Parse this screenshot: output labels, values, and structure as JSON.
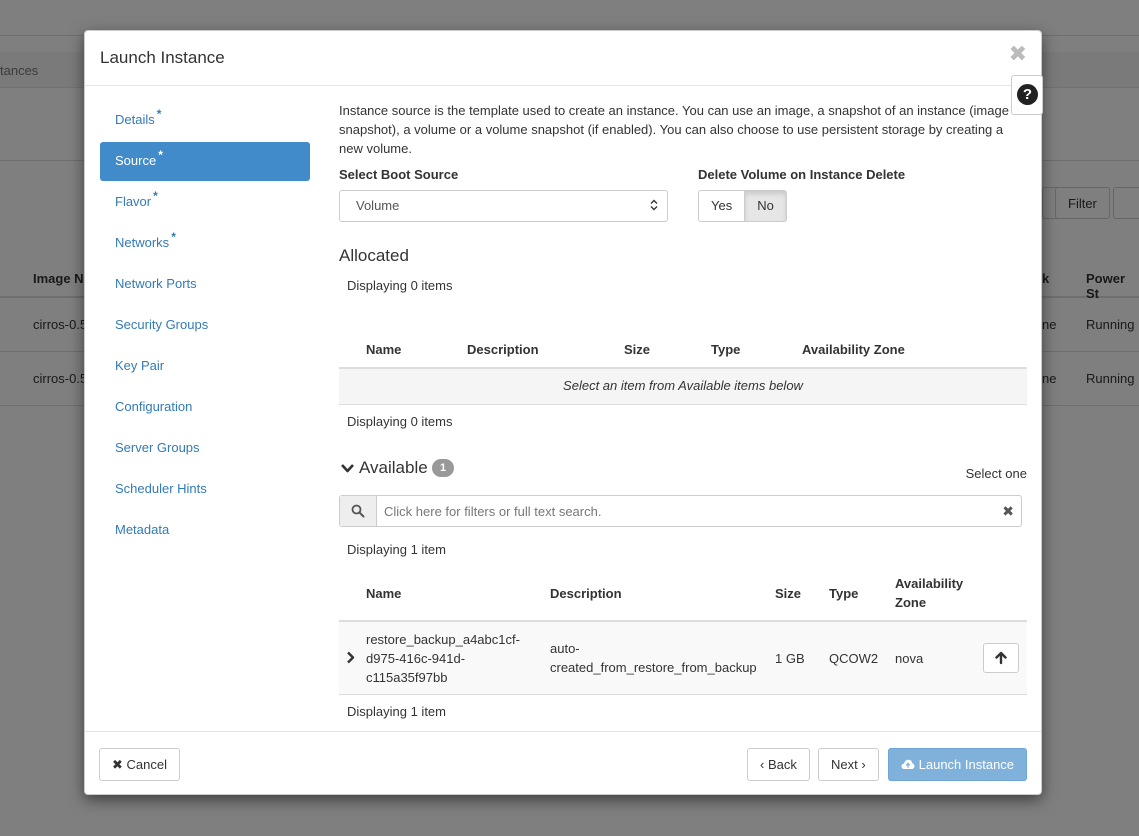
{
  "background": {
    "breadcrumb": "tances",
    "buttons": [
      "Filter"
    ],
    "columns": [
      "Image N",
      "k",
      "Power St"
    ],
    "rows": [
      {
        "image": "cirros-0.5",
        "net": "ne",
        "power": "Running"
      },
      {
        "image": "cirros-0.5",
        "net": "ne",
        "power": "Running"
      }
    ]
  },
  "modal": {
    "title": "Launch Instance",
    "close_glyph": "✖",
    "help_glyph": "?"
  },
  "sidebar": {
    "required_marker": "*",
    "items": [
      {
        "label": "Details",
        "required": true
      },
      {
        "label": "Source",
        "required": true,
        "active": true
      },
      {
        "label": "Flavor",
        "required": true
      },
      {
        "label": "Networks",
        "required": true
      },
      {
        "label": "Network Ports"
      },
      {
        "label": "Security Groups"
      },
      {
        "label": "Key Pair"
      },
      {
        "label": "Configuration"
      },
      {
        "label": "Server Groups"
      },
      {
        "label": "Scheduler Hints"
      },
      {
        "label": "Metadata"
      }
    ]
  },
  "source": {
    "intro": "Instance source is the template used to create an instance. You can use an image, a snapshot of an instance (image snapshot), a volume or a volume snapshot (if enabled). You can also choose to use persistent storage by creating a new volume.",
    "boot_source_label": "Select Boot Source",
    "boot_source_value": "Volume",
    "delete_volume_label": "Delete Volume on Instance Delete",
    "yes_label": "Yes",
    "no_label": "No",
    "selected_delete_option": "No"
  },
  "allocated": {
    "title": "Allocated",
    "displaying_top": "Displaying 0 items",
    "displaying_bottom": "Displaying 0 items",
    "columns": [
      "Name",
      "Description",
      "Size",
      "Type",
      "Availability Zone"
    ],
    "empty_message": "Select an item from Available items below"
  },
  "available": {
    "title": "Available",
    "count": "1",
    "select_hint": "Select one",
    "search_placeholder": "Click here for filters or full text search.",
    "displaying_top": "Displaying 1 item",
    "displaying_bottom": "Displaying 1 item",
    "columns": [
      "Name",
      "Description",
      "Size",
      "Type",
      "Availability",
      "Zone"
    ],
    "rows": [
      {
        "name_lines": [
          "restore_backup_a4abc1cf-",
          "d975-416c-941d-",
          "c115a35f97bb"
        ],
        "description_lines": [
          "auto-",
          "created_from_restore_from_backup"
        ],
        "size": "1 GB",
        "type": "QCOW2",
        "zone": "nova"
      }
    ]
  },
  "footer": {
    "cancel": "Cancel",
    "back": "Back",
    "next": "Next",
    "launch": "Launch Instance"
  },
  "colors": {
    "accent": "#428bca",
    "primary_disabled": "#7fb1db",
    "link": "#337ab7"
  }
}
